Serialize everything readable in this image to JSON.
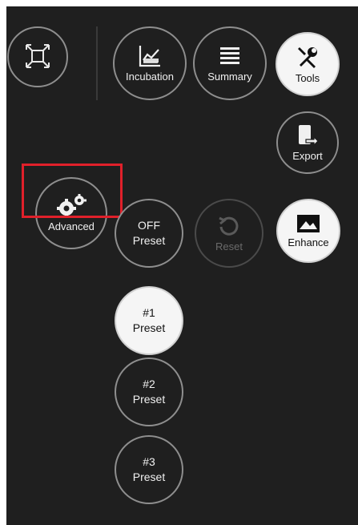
{
  "toolbar": {
    "fullscreen": {
      "label": ""
    },
    "incubation": {
      "label": "Incubation"
    },
    "summary": {
      "label": "Summary"
    },
    "tools": {
      "label": "Tools"
    }
  },
  "tools_menu": {
    "export": {
      "label": "Export"
    },
    "advanced": {
      "label": "Advanced"
    },
    "reset": {
      "label": "Reset"
    },
    "enhance": {
      "label": "Enhance"
    }
  },
  "presets": [
    {
      "line1": "OFF",
      "line2": "Preset",
      "selected": false
    },
    {
      "line1": "#1",
      "line2": "Preset",
      "selected": true
    },
    {
      "line1": "#2",
      "line2": "Preset",
      "selected": false
    },
    {
      "line1": "#3",
      "line2": "Preset",
      "selected": false
    }
  ],
  "colors": {
    "background": "#1f1f1f",
    "button_border": "#8e8e8e",
    "active_fill": "#f5f5f5",
    "highlight": "#e0202a"
  },
  "icons": {
    "fullscreen": "fullscreen-icon",
    "incubation": "chart-icon",
    "summary": "list-icon",
    "tools": "wrench-screwdriver-icon",
    "export": "export-icon",
    "advanced": "gears-icon",
    "reset": "reset-icon",
    "enhance": "image-icon"
  }
}
